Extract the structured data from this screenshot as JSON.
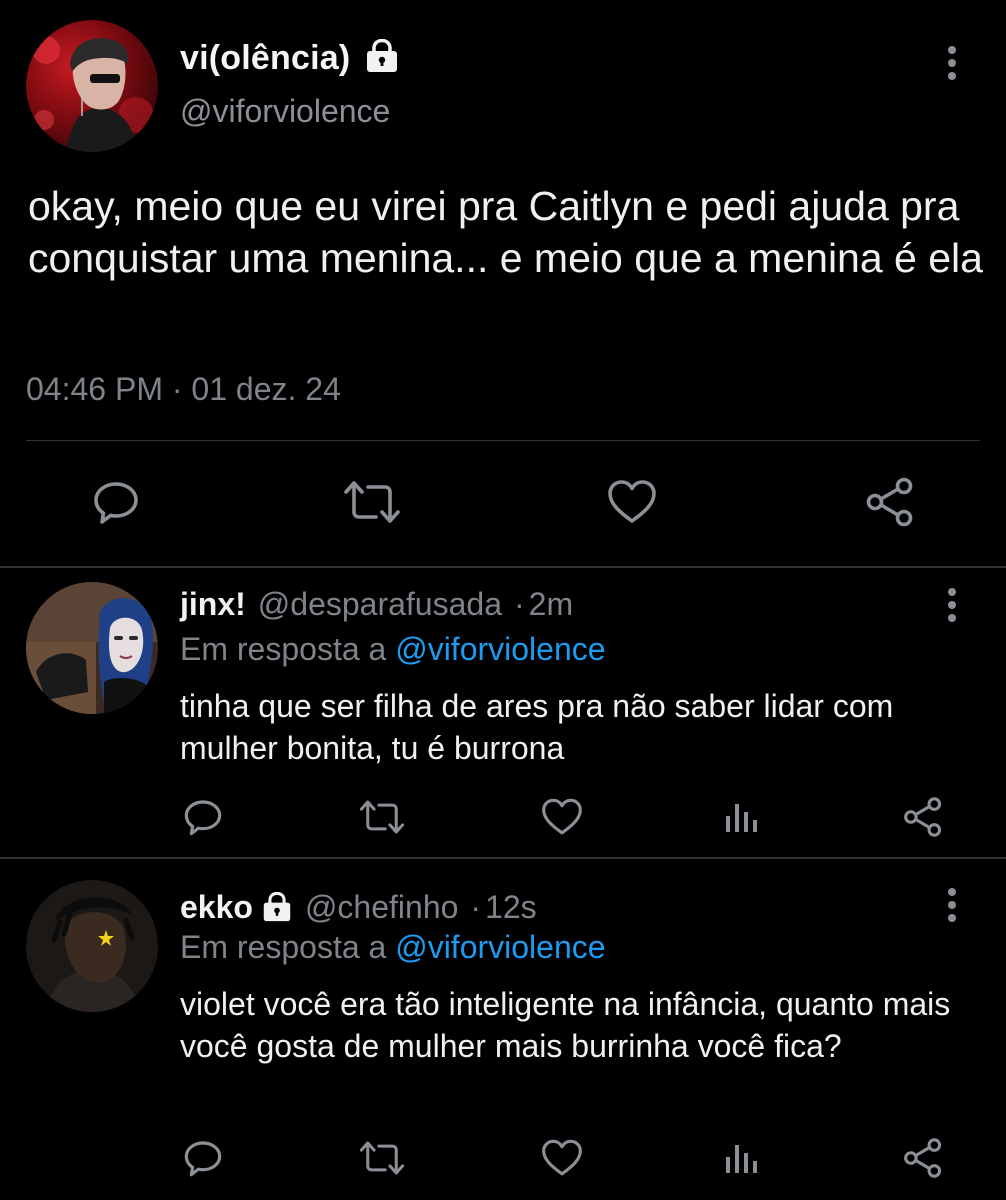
{
  "main_tweet": {
    "display_name": "vi(olência)",
    "handle": "@viforviolence",
    "text": "okay, meio que eu virei pra Caitlyn e pedi ajuda pra conquistar uma menina... e meio que a menina é ela",
    "timestamp": "04:46 PM · 01 dez. 24",
    "actions": [
      "reply-icon",
      "retweet-icon",
      "like-icon",
      "share-icon"
    ]
  },
  "replies": [
    {
      "display_name": "jinx!",
      "handle": "@desparafusada",
      "separator": "·",
      "time": "2m",
      "reply_prefix": "Em resposta a",
      "reply_mention": "@viforviolence",
      "text": "tinha que ser filha de ares pra não saber lidar com mulher bonita, tu é burrona",
      "actions": [
        "reply-icon",
        "retweet-icon",
        "like-icon",
        "views-icon",
        "share-icon"
      ]
    },
    {
      "display_name": "ekko",
      "handle": "@chefinho",
      "separator": "·",
      "time": "12s",
      "reply_prefix": "Em resposta a",
      "reply_mention": "@viforviolence",
      "text": "violet você era tão inteligente na infância, quanto mais você gosta de mulher mais burrinha você fica?",
      "actions": [
        "reply-icon",
        "retweet-icon",
        "like-icon",
        "views-icon",
        "share-icon"
      ]
    }
  ],
  "colors": {
    "background": "#000000",
    "text": "#f0f0f0",
    "secondary_text": "#7e848a",
    "mention": "#1d9bf0",
    "divider": "#2f3336",
    "icon": "#8b9096"
  }
}
